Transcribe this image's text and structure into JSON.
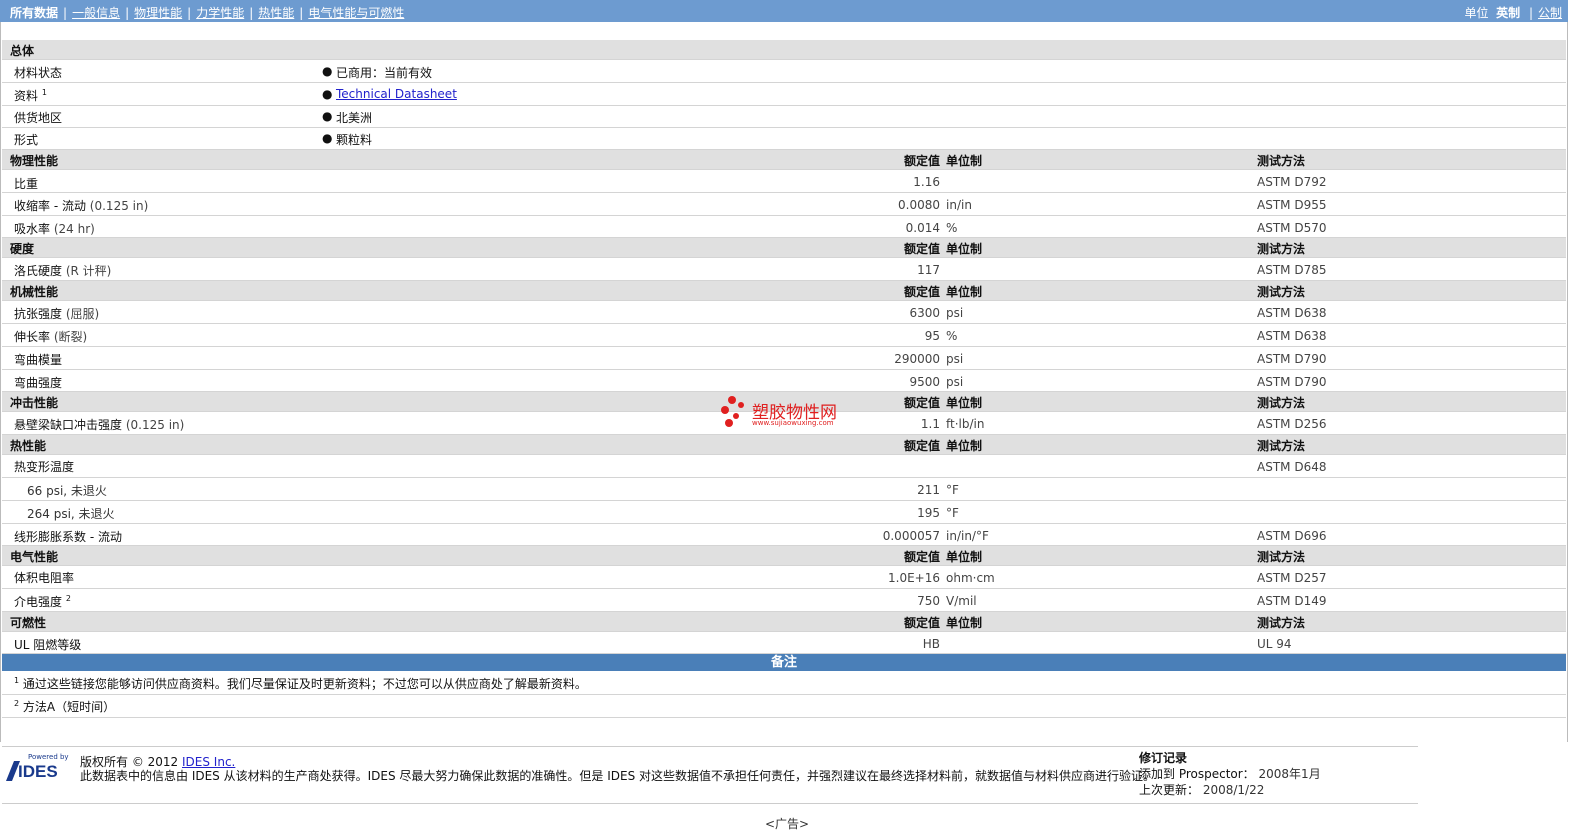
{
  "nav": {
    "all_data": "所有数据",
    "tabs": [
      "一般信息",
      "物理性能",
      "力学性能",
      "热性能",
      "电气性能与可燃性"
    ],
    "units_label": "单位",
    "unit_english": "英制",
    "unit_metric": "公制"
  },
  "general": {
    "title": "总体",
    "rows": [
      {
        "label": "材料状态",
        "value": "已商用：当前有效"
      },
      {
        "label": "资料",
        "sup": "1",
        "value": "Technical Datasheet"
      },
      {
        "label": "供货地区",
        "value": "北美洲"
      },
      {
        "label": "形式",
        "value": "颗粒料"
      }
    ]
  },
  "headers": {
    "nominal": "额定值",
    "unit": "单位制",
    "test": "测试方法"
  },
  "physical": {
    "title": "物理性能",
    "rows": [
      {
        "name": "比重",
        "value": "1.16",
        "unit": "",
        "test": "ASTM D792"
      },
      {
        "name": "收缩率 - 流动",
        "cond": "(0.125 in)",
        "value": "0.0080",
        "unit": "in/in",
        "test": "ASTM D955"
      },
      {
        "name": "吸水率",
        "cond": "(24 hr)",
        "value": "0.014",
        "unit": "%",
        "test": "ASTM D570"
      }
    ]
  },
  "hardness": {
    "title": "硬度",
    "rows": [
      {
        "name": "洛氏硬度",
        "cond": "(R 计秤)",
        "value": "117",
        "unit": "",
        "test": "ASTM D785"
      }
    ]
  },
  "mechanical": {
    "title": "机械性能",
    "rows": [
      {
        "name": "抗张强度",
        "cond": "(屈服)",
        "value": "6300",
        "unit": "psi",
        "test": "ASTM D638"
      },
      {
        "name": "伸长率",
        "cond": "(断裂)",
        "value": "95",
        "unit": "%",
        "test": "ASTM D638"
      },
      {
        "name": "弯曲模量",
        "value": "290000",
        "unit": "psi",
        "test": "ASTM D790"
      },
      {
        "name": "弯曲强度",
        "value": "9500",
        "unit": "psi",
        "test": "ASTM D790"
      }
    ]
  },
  "impact": {
    "title": "冲击性能",
    "rows": [
      {
        "name": "悬壁梁缺口冲击强度",
        "cond": "(0.125 in)",
        "value": "1.1",
        "unit": "ft·lb/in",
        "test": "ASTM D256"
      }
    ]
  },
  "thermal": {
    "title": "热性能",
    "rows": [
      {
        "name": "热变形温度",
        "value": "",
        "unit": "",
        "test": "ASTM D648"
      },
      {
        "name": "66 psi, 未退火",
        "value": "211",
        "unit": "°F",
        "test": ""
      },
      {
        "name": "264 psi, 未退火",
        "value": "195",
        "unit": "°F",
        "test": ""
      },
      {
        "name": "线形膨胀系数 - 流动",
        "value": "0.000057",
        "unit": "in/in/°F",
        "test": "ASTM D696"
      }
    ]
  },
  "electrical": {
    "title": "电气性能",
    "rows": [
      {
        "name": "体积电阻率",
        "value": "1.0E+16",
        "unit": "ohm·cm",
        "test": "ASTM D257"
      },
      {
        "name": "介电强度",
        "sup": "2",
        "value": "750",
        "unit": "V/mil",
        "test": "ASTM D149"
      }
    ]
  },
  "flammability": {
    "title": "可燃性",
    "rows": [
      {
        "name": "UL 阻燃等级",
        "value": "HB",
        "unit": "",
        "test": "UL 94"
      }
    ]
  },
  "notes": {
    "title": "备注",
    "items": [
      {
        "num": "1",
        "text": "通过这些链接您能够访问供应商资料。我们尽量保证及时更新资料；不过您可以从供应商处了解最新资料。"
      },
      {
        "num": "2",
        "text": "方法A（短时间）"
      }
    ]
  },
  "footer": {
    "powered_by": "Powered by",
    "logo_text": "IDES",
    "copyright": "版权所有 © 2012",
    "company_link": "IDES Inc.",
    "disclaimer": "此数据表中的信息由 IDES 从该材料的生产商处获得。IDES 尽最大努力确保此数据的准确性。但是 IDES 对这些数据值不承担任何责任，并强烈建议在最终选择材料前，就数据值与材料供应商进行验证。",
    "revision_title": "修订记录",
    "added_label": "添加到 Prospector：",
    "added_value": "2008年1月",
    "updated_label": "上次更新：",
    "updated_value": "2008/1/22"
  },
  "ad_label": "<广告>",
  "watermark": {
    "text": "塑胶物性网",
    "url": "www.sujiaowuxing.com"
  },
  "colors": {
    "nav_bg": "#6d9bd0",
    "section_bg": "#e0e0e0",
    "notes_bg": "#4a7fb8",
    "link": "#2222cc",
    "watermark": "#e02020"
  }
}
